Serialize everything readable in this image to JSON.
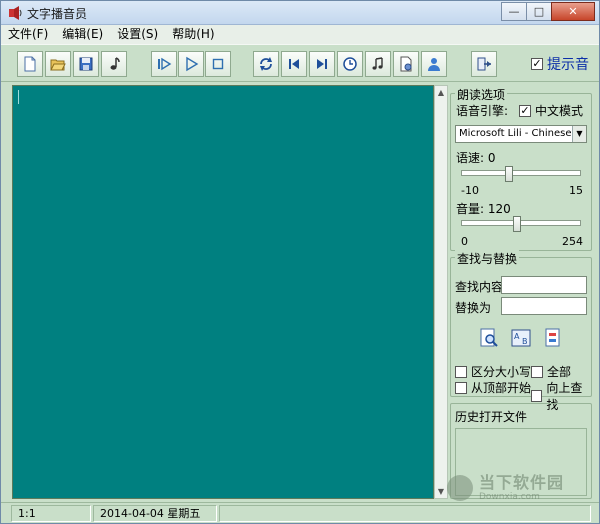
{
  "window": {
    "title": "文字播音员",
    "controls": [
      "—",
      "□",
      "✕"
    ]
  },
  "menu": [
    "文件(F)",
    "编辑(E)",
    "设置(S)",
    "帮助(H)"
  ],
  "toolbar": {
    "hint_label": "提示音",
    "hint_checked": "✓"
  },
  "reading_options": {
    "title": "朗读选项",
    "engine_label": "语音引擎:",
    "chinese_mode_label": "中文模式",
    "chinese_mode_checked": "✓",
    "engine_value": "Microsoft Lili - Chinese (China)",
    "speed_label": "语速:",
    "speed_value": "0",
    "speed_min": "-10",
    "speed_max": "15",
    "speed_fraction": 0.4,
    "volume_label": "音量:",
    "volume_value": "120",
    "volume_min": "0",
    "volume_max": "254",
    "volume_fraction": 0.47
  },
  "find_replace": {
    "title": "查找与替换",
    "find_label": "查找内容",
    "replace_label": "替换为",
    "find_value": "",
    "replace_value": "",
    "options": {
      "match_case": "区分大小写",
      "all": "全部",
      "from_top": "从顶部开始",
      "search_up": "向上查找"
    }
  },
  "history": {
    "title": "历史打开文件"
  },
  "status": {
    "position": "1:1",
    "date": "2014-04-04 星期五"
  },
  "watermark": {
    "cn": "当下软件园",
    "en": "Downxia.com"
  },
  "colors": {
    "editor_bg": "#008080",
    "panel_bg": "#c9dfc9",
    "hint_text": "#0b2ea8"
  }
}
